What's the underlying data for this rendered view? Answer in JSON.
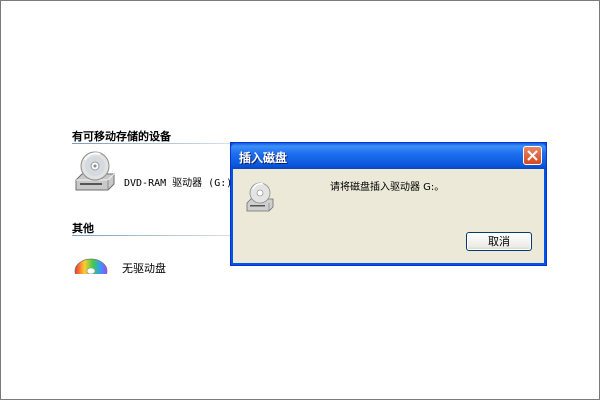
{
  "explorer": {
    "removable_section_header": "有可移动存储的设备",
    "drive_item_label": "DVD-RAM 驱动器 (G:)",
    "other_section_header": "其他",
    "other_item_label": "无驱动盘"
  },
  "dialog": {
    "title": "插入磁盘",
    "message": "请将磁盘插入驱动器 G:。",
    "cancel_label": "取消"
  },
  "colors": {
    "titlebar": "#0a58dc",
    "dialog_bg": "#ece9d8",
    "close_button": "#d6481f"
  },
  "icons": {
    "drive": "optical-drive-icon",
    "dialog": "disc-drive-icon",
    "close": "close-icon",
    "other": "disc-icon"
  }
}
